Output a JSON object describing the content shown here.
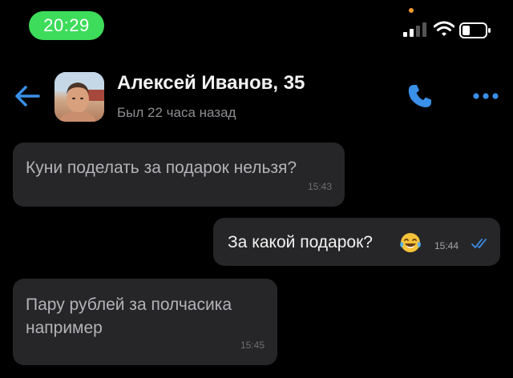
{
  "status_bar": {
    "time": "20:29",
    "pill_color": "#3ddc5a",
    "indicator_color": "#f29a2e"
  },
  "header": {
    "contact_name": "Алексей Иванов, 35",
    "last_seen": "Был 22 часа назад",
    "accent_color": "#3a8fe8",
    "icons": [
      "back-arrow-icon",
      "avatar",
      "phone-icon",
      "more-options-icon"
    ]
  },
  "messages": [
    {
      "direction": "incoming",
      "text": "Куни поделать за подарок нельзя?",
      "time": "15:43"
    },
    {
      "direction": "outgoing",
      "text": "За какой подарок?",
      "emoji": "😂",
      "time": "15:44",
      "status": "read"
    },
    {
      "direction": "incoming",
      "text": "Пару рублей за полчасика например",
      "time": "15:45"
    }
  ]
}
